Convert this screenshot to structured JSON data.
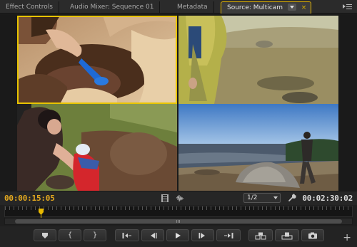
{
  "tabs": [
    {
      "label": "Effect Controls"
    },
    {
      "label": "Audio Mixer: Sequence 01"
    },
    {
      "label": "Metadata"
    },
    {
      "label": "Source: Multicam",
      "active": true
    }
  ],
  "tab_close_glyph": "×",
  "panel_menu_icon": "panel-menu-icon",
  "multicam": {
    "selected_angle": 1,
    "angles": [
      {
        "id": 1,
        "scene": "hand digging in sand with blue shovel"
      },
      {
        "id": 2,
        "scene": "person in green jacket on rocky shore"
      },
      {
        "id": 3,
        "scene": "woman helping child in red jacket"
      },
      {
        "id": 4,
        "scene": "man walking on rocky beach by sea"
      }
    ]
  },
  "timecode": {
    "current": "00:00:15:05",
    "duration": "00:02:30:02"
  },
  "zoom": {
    "selected": "1/2"
  },
  "playhead_fraction": 0.103,
  "colors": {
    "accent": "#e8c400",
    "timecode_current": "#e3a81f",
    "timecode_duration": "#dcdcdc",
    "background": "#1f1f1f"
  },
  "transport": [
    {
      "name": "add-marker-button",
      "icon": "marker-icon"
    },
    {
      "name": "mark-in-button",
      "icon": "mark-in-icon",
      "glyph": "{"
    },
    {
      "name": "mark-out-button",
      "icon": "mark-out-icon",
      "glyph": "}"
    },
    {
      "name": "go-to-in-button",
      "icon": "go-to-in-icon"
    },
    {
      "name": "step-back-button",
      "icon": "step-back-icon"
    },
    {
      "name": "play-button",
      "icon": "play-icon"
    },
    {
      "name": "step-forward-button",
      "icon": "step-forward-icon"
    },
    {
      "name": "go-to-out-button",
      "icon": "go-to-out-icon"
    },
    {
      "name": "insert-button",
      "icon": "insert-icon"
    },
    {
      "name": "overwrite-button",
      "icon": "overwrite-icon"
    },
    {
      "name": "export-frame-button",
      "icon": "camera-icon"
    }
  ],
  "add_button_glyph": "+"
}
